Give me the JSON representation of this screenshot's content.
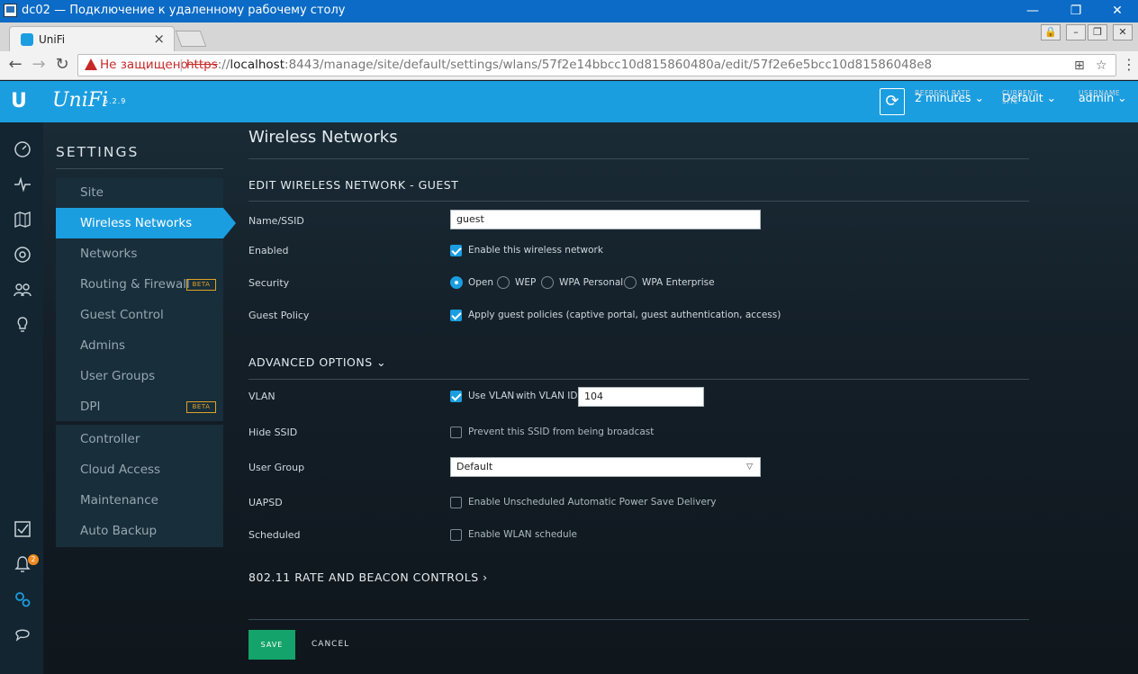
{
  "window": {
    "title": "dc02 — Подключение к удаленному рабочему столу",
    "minimize": "—",
    "restore": "❐",
    "close": "✕"
  },
  "browser": {
    "tab_title": "UniFi",
    "tab_close": "×",
    "security_warning": "Не защищено",
    "url_scheme": "https",
    "url_sep": "://",
    "url_host": "localhost",
    "url_rest": ":8443/manage/site/default/settings/wlans/57f2e14bbcc10d815860480a/edit/57f2e6e5bcc10d81586048e8"
  },
  "header": {
    "logo": "U",
    "brand": "UniFi",
    "version": "5.2.9",
    "refresh_rate_label": "REFRESH RATE",
    "refresh_rate_value": "2 minutes",
    "current_site_label": "CURRENT SITE",
    "current_site_value": "Default",
    "username_label": "USERNAME",
    "username_value": "admin"
  },
  "rail": {
    "alerts_count": "2"
  },
  "sidebar": {
    "title": "SETTINGS",
    "items": [
      {
        "label": "Site"
      },
      {
        "label": "Wireless Networks"
      },
      {
        "label": "Networks"
      },
      {
        "label": "Routing & Firewall",
        "badge": "BETA"
      },
      {
        "label": "Guest Control"
      },
      {
        "label": "Admins"
      },
      {
        "label": "User Groups"
      },
      {
        "label": "DPI",
        "badge": "BETA"
      },
      {
        "label": "Controller"
      },
      {
        "label": "Cloud Access"
      },
      {
        "label": "Maintenance"
      },
      {
        "label": "Auto Backup"
      }
    ]
  },
  "page": {
    "title": "Wireless Networks",
    "section_title": "EDIT WIRELESS NETWORK - GUEST",
    "fields": {
      "name_label": "Name/SSID",
      "name_value": "guest",
      "enabled_label": "Enabled",
      "enabled_text": "Enable this wireless network",
      "security_label": "Security",
      "security_options": [
        "Open",
        "WEP",
        "WPA Personal",
        "WPA Enterprise"
      ],
      "guest_policy_label": "Guest Policy",
      "guest_policy_text": "Apply guest policies (captive portal, guest authentication, access)"
    },
    "advanced_title": "ADVANCED OPTIONS",
    "advanced": {
      "vlan_label": "VLAN",
      "vlan_text": "Use VLAN",
      "vlan_id_text": "with VLAN ID",
      "vlan_id_value": "104",
      "hide_ssid_label": "Hide SSID",
      "hide_ssid_text": "Prevent this SSID from being broadcast",
      "user_group_label": "User Group",
      "user_group_value": "Default",
      "uapsd_label": "UAPSD",
      "uapsd_text": "Enable Unscheduled Automatic Power Save Delivery",
      "scheduled_label": "Scheduled",
      "scheduled_text": "Enable WLAN schedule"
    },
    "rate_beacon_title": "802.11 RATE AND BEACON CONTROLS",
    "save_label": "SAVE",
    "cancel_label": "CANCEL"
  }
}
